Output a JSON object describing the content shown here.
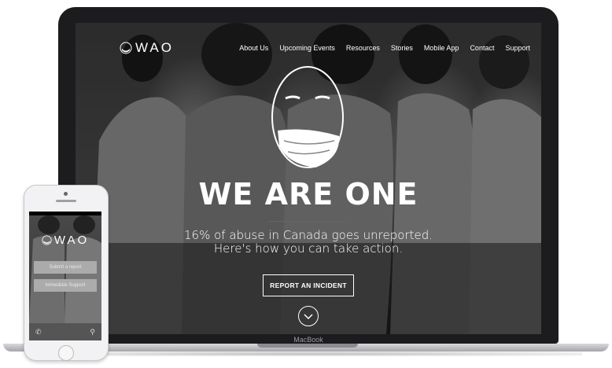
{
  "site": {
    "logo_text": "WAO",
    "nav": [
      "About Us",
      "Upcoming Events",
      "Resources",
      "Stories",
      "Mobile App",
      "Contact",
      "Support"
    ],
    "hero_title": "WE ARE ONE",
    "hero_subtitle_line1": "16% of abuse in Canada goes unreported.",
    "hero_subtitle_line2": "Here's how you can take action.",
    "report_button": "REPORT AN INCIDENT",
    "scroll_icon": "chevron-down-icon",
    "accent_color": "#d33333"
  },
  "device": {
    "laptop_brand": "MacBook"
  },
  "phone": {
    "logo_text": "WAO",
    "button1": "Submit a report",
    "button2": "Immediate Support",
    "phone_icon": "phone-icon",
    "location_icon": "location-pin-icon"
  }
}
